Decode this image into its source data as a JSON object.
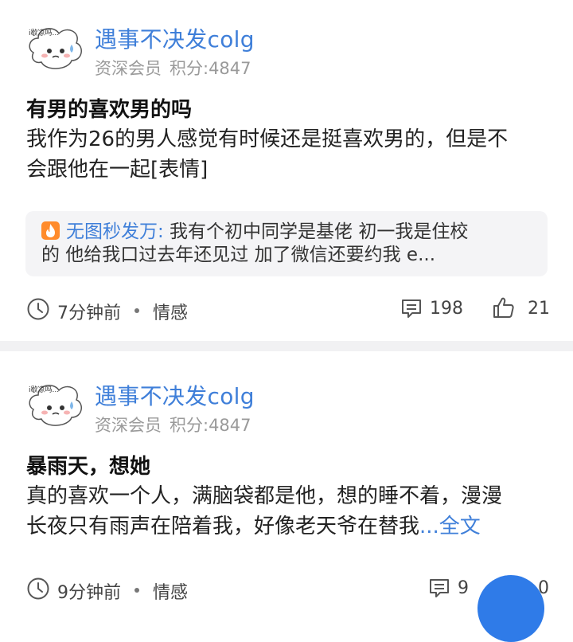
{
  "posts": [
    {
      "author": "遇事不决发colg",
      "badge": "资深会员",
      "points": "积分:4847",
      "avatar_caption": "i歇凉吗...",
      "title": "有男的喜欢男的吗",
      "body_line1": "我作为26的男人感觉有时候还是挺喜欢男的，但是不",
      "body_line2": "会跟他在一起[表情]",
      "top_comment": {
        "user": "无图秒发万:",
        "text_line1": " 我有个初中同学是基佬   初一我是住校",
        "text_line2": "的   他给我口过去年还见过   加了微信还要约我   e..."
      },
      "time": "7分钟前",
      "category": "情感",
      "comments": "198",
      "likes": "21"
    },
    {
      "author": "遇事不决发colg",
      "badge": "资深会员",
      "points": "积分:4847",
      "avatar_caption": "i歇凉吗...",
      "title": "暴雨天，想她",
      "body_line1": "真的喜欢一个人，满脑袋都是他，想的睡不着，漫漫",
      "body_line2": "长夜只有雨声在陪着我，好像老天爷在替我",
      "more_label": "...全文",
      "time": "9分钟前",
      "category": "情感",
      "comments": "9",
      "likes": "0"
    }
  ],
  "icons": {
    "time": "clock-icon",
    "comment": "comment-icon",
    "like": "thumbs-up-icon",
    "hot": "fire-icon"
  },
  "colors": {
    "accent": "#3f7fd9",
    "divider": "#f1f1f3",
    "fab": "#2f7be8"
  }
}
